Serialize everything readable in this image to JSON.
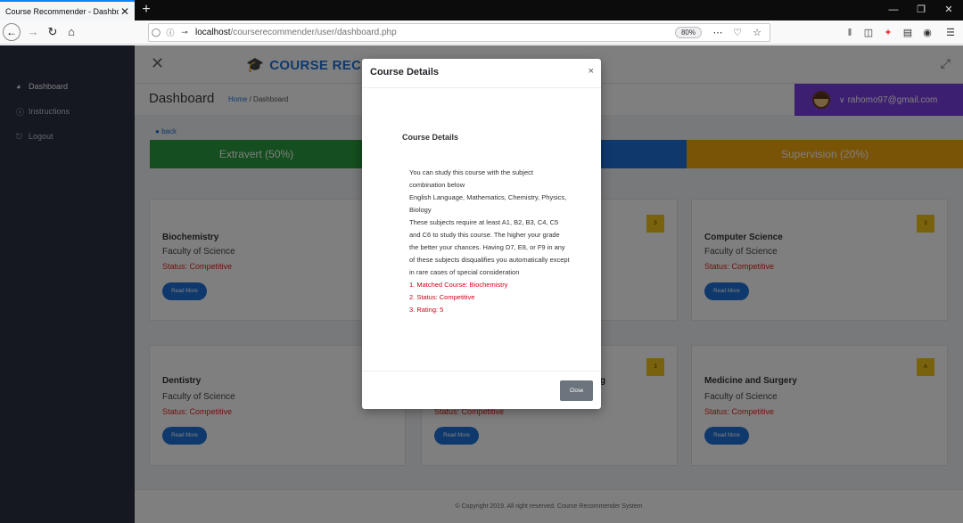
{
  "browser": {
    "tab_title": "Course Recommender - Dashboard",
    "tab_close": "✕",
    "new_tab": "+",
    "url_host": "localhost",
    "url_path": "/courserecommender/user/dashboard.php",
    "zoom": "80%",
    "window_controls": [
      "—",
      "❐",
      "✕"
    ]
  },
  "sidebar": {
    "items": [
      {
        "label": "Dashboard",
        "icon": "dashboard-icon"
      },
      {
        "label": "Instructions",
        "icon": "info-icon"
      },
      {
        "label": "Logout",
        "icon": "logout-icon"
      }
    ]
  },
  "topbar": {
    "brand": "COURSE RECOM"
  },
  "header": {
    "title": "Dashboard",
    "crumb_home": "Home",
    "crumb_sep": "/",
    "crumb_current": "Dashboard",
    "user_email": "rahomo97@gmail.com"
  },
  "back_label": "back",
  "bars": [
    {
      "label": "Extravert (50%)",
      "color": "#2a9d3e"
    },
    {
      "label": "",
      "color": "#1f72d8"
    },
    {
      "label": "Supervision (20%)",
      "color": "#f2a90f"
    }
  ],
  "cards": [
    {
      "title": "Biochemistry",
      "faculty": "Faculty of Science",
      "status": "Status: Competitive",
      "button": "Read More",
      "badge": ""
    },
    {
      "title": "",
      "faculty": "",
      "status": "",
      "button": "",
      "badge": "3"
    },
    {
      "title": "Computer Science",
      "faculty": "Faculty of Science",
      "status": "Status: Competitive",
      "button": "Read More",
      "badge": "3"
    },
    {
      "title": "Dentistry",
      "faculty": "Faculty of Science",
      "status": "Status: Competitive",
      "button": "Read More",
      "badge": ""
    },
    {
      "title": "g",
      "faculty": "",
      "status": "Status: Competitive",
      "button": "Read More",
      "badge": "3"
    },
    {
      "title": "Medicine and Surgery",
      "faculty": "Faculty of Science",
      "status": "Status: Competitive",
      "button": "Read More",
      "badge": "A"
    }
  ],
  "footer": "© Copyright 2019. All right reserved. Course Recommender System",
  "modal": {
    "title": "Course Details",
    "close_x": "×",
    "subtitle": "Course Details",
    "lines": [
      "You can study this course with the subject combination below",
      "English Language, Mathematics, Chemistry, Physics, Biology",
      "These subjects require at least A1, B2, B3, C4, C5 and C6 to study this course. The higher your grade the better your chances. Having D7, E8, or F9 in any of these subjects disqualifies you automatically except in rare cases of special consideration"
    ],
    "results": [
      "1. Matched Course: Biochemistry",
      "2. Status: Competitive",
      "3. Rating: 5"
    ],
    "close_button": "Close"
  }
}
